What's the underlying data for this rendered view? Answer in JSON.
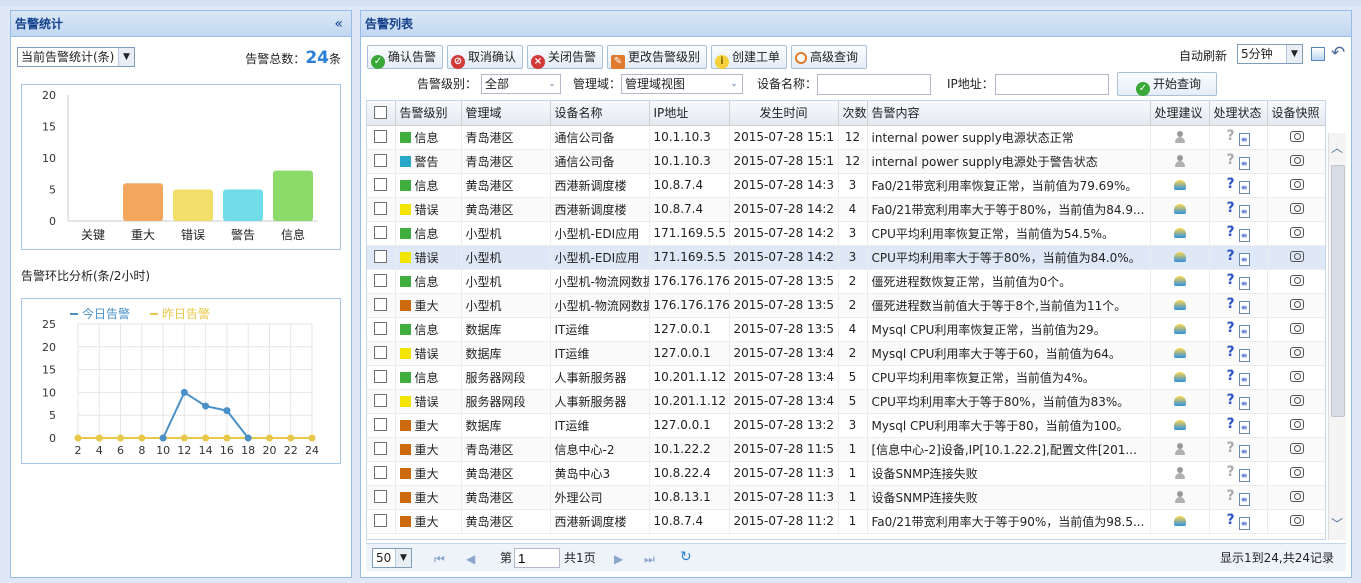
{
  "left_panel": {
    "title": "告警统计",
    "stat_select": "当前告警统计(条)",
    "total_label": "告警总数：",
    "total_value": "24",
    "total_unit": "条",
    "trend_title": "告警环比分析(条/2小时)"
  },
  "right_panel": {
    "title": "告警列表",
    "toolbar": [
      {
        "label": "确认告警",
        "icon": "check-icon"
      },
      {
        "label": "取消确认",
        "icon": "cancel-icon"
      },
      {
        "label": "关闭告警",
        "icon": "close-icon"
      },
      {
        "label": "更改告警级别",
        "icon": "edit-icon"
      },
      {
        "label": "创建工单",
        "icon": "lightbulb-icon"
      },
      {
        "label": "高级查询",
        "icon": "search-icon"
      }
    ],
    "auto_refresh_label": "自动刷新",
    "auto_refresh_value": "5分钟",
    "filters": {
      "level_label": "告警级别：",
      "level_value": "全部",
      "domain_label": "管理域：",
      "domain_value": "管理域视图",
      "device_label": "设备名称：",
      "device_value": "",
      "ip_label": "IP地址：",
      "ip_value": "",
      "search_label": "开始查询"
    },
    "columns": [
      "告警级别",
      "管理域",
      "设备名称",
      "IP地址",
      "发生时间",
      "次数",
      "告警内容",
      "处理建议",
      "处理状态",
      "设备快照"
    ],
    "rows": [
      {
        "level": "信息",
        "color": "#3fae3f",
        "domain": "青岛港区",
        "device": "通信公司备",
        "ip": "10.1.10.3",
        "time": "2015-07-28 15:1",
        "count": "12",
        "content": "internal power supply电源状态正常",
        "sugg": "person"
      },
      {
        "level": "警告",
        "color": "#29a7c8",
        "domain": "青岛港区",
        "device": "通信公司备",
        "ip": "10.1.10.3",
        "time": "2015-07-28 15:1",
        "count": "12",
        "content": "internal power supply电源处于警告状态",
        "sugg": "person"
      },
      {
        "level": "信息",
        "color": "#3fae3f",
        "domain": "黄岛港区",
        "device": "西港新调度楼",
        "ip": "10.8.7.4",
        "time": "2015-07-28 14:3",
        "count": "3",
        "content": "Fa0/21带宽利用率恢复正常，当前值为79.69%。",
        "sugg": "bulb"
      },
      {
        "level": "错误",
        "color": "#f2e600",
        "domain": "黄岛港区",
        "device": "西港新调度楼",
        "ip": "10.8.7.4",
        "time": "2015-07-28 14:2",
        "count": "4",
        "content": "Fa0/21带宽利用率大于等于80%，当前值为84.9...",
        "sugg": "bulb"
      },
      {
        "level": "信息",
        "color": "#3fae3f",
        "domain": "小型机",
        "device": "小型机-EDI应用",
        "ip": "171.169.5.5",
        "time": "2015-07-28 14:2",
        "count": "3",
        "content": "CPU平均利用率恢复正常，当前值为54.5%。",
        "sugg": "bulb"
      },
      {
        "level": "错误",
        "color": "#f2e600",
        "domain": "小型机",
        "device": "小型机-EDI应用",
        "ip": "171.169.5.5",
        "time": "2015-07-28 14:2",
        "count": "3",
        "content": "CPU平均利用率大于等于80%，当前值为84.0%。",
        "sugg": "bulb",
        "hl": true
      },
      {
        "level": "信息",
        "color": "#3fae3f",
        "domain": "小型机",
        "device": "小型机-物流网数据",
        "ip": "176.176.176",
        "time": "2015-07-28 13:5",
        "count": "2",
        "content": "僵死进程数恢复正常，当前值为0个。",
        "sugg": "bulb"
      },
      {
        "level": "重大",
        "color": "#cc6a10",
        "domain": "小型机",
        "device": "小型机-物流网数据",
        "ip": "176.176.176",
        "time": "2015-07-28 13:5",
        "count": "2",
        "content": "僵死进程数当前值大于等于8个,当前值为11个。",
        "sugg": "bulb"
      },
      {
        "level": "信息",
        "color": "#3fae3f",
        "domain": "数据库",
        "device": "IT运维",
        "ip": "127.0.0.1",
        "time": "2015-07-28 13:5",
        "count": "4",
        "content": "Mysql CPU利用率恢复正常，当前值为29。",
        "sugg": "bulb"
      },
      {
        "level": "错误",
        "color": "#f2e600",
        "domain": "数据库",
        "device": "IT运维",
        "ip": "127.0.0.1",
        "time": "2015-07-28 13:4",
        "count": "2",
        "content": "Mysql CPU利用率大于等于60，当前值为64。",
        "sugg": "bulb"
      },
      {
        "level": "信息",
        "color": "#3fae3f",
        "domain": "服务器网段",
        "device": "人事新服务器",
        "ip": "10.201.1.12",
        "time": "2015-07-28 13:4",
        "count": "5",
        "content": "CPU平均利用率恢复正常，当前值为4%。",
        "sugg": "bulb"
      },
      {
        "level": "错误",
        "color": "#f2e600",
        "domain": "服务器网段",
        "device": "人事新服务器",
        "ip": "10.201.1.12",
        "time": "2015-07-28 13:4",
        "count": "5",
        "content": "CPU平均利用率大于等于80%，当前值为83%。",
        "sugg": "bulb"
      },
      {
        "level": "重大",
        "color": "#cc6a10",
        "domain": "数据库",
        "device": "IT运维",
        "ip": "127.0.0.1",
        "time": "2015-07-28 13:2",
        "count": "3",
        "content": "Mysql CPU利用率大于等于80，当前值为100。",
        "sugg": "bulb"
      },
      {
        "level": "重大",
        "color": "#cc6a10",
        "domain": "青岛港区",
        "device": "信息中心-2",
        "ip": "10.1.22.2",
        "time": "2015-07-28 11:5",
        "count": "1",
        "content": "[信息中心-2]设备,IP[10.1.22.2],配置文件[201...",
        "sugg": "person"
      },
      {
        "level": "重大",
        "color": "#cc6a10",
        "domain": "黄岛港区",
        "device": "黄岛中心3",
        "ip": "10.8.22.4",
        "time": "2015-07-28 11:3",
        "count": "1",
        "content": "设备SNMP连接失败",
        "sugg": "person"
      },
      {
        "level": "重大",
        "color": "#cc6a10",
        "domain": "黄岛港区",
        "device": "外理公司",
        "ip": "10.8.13.1",
        "time": "2015-07-28 11:3",
        "count": "1",
        "content": "设备SNMP连接失败",
        "sugg": "person"
      },
      {
        "level": "重大",
        "color": "#cc6a10",
        "domain": "黄岛港区",
        "device": "西港新调度楼",
        "ip": "10.8.7.4",
        "time": "2015-07-28 11:2",
        "count": "1",
        "content": "Fa0/21带宽利用率大于等于90%，当前值为98.5...",
        "sugg": "bulb"
      }
    ],
    "pager": {
      "page_size": "50",
      "page_prefix": "第",
      "page_value": "1",
      "page_total": "共1页",
      "summary": "显示1到24,共24记录"
    }
  },
  "chart_data": [
    {
      "type": "bar",
      "categories": [
        "关键",
        "重大",
        "错误",
        "警告",
        "信息"
      ],
      "values": [
        0,
        6,
        5,
        5,
        8
      ],
      "colors": [
        "#f29c4c",
        "#f29c4c",
        "#f0dc5a",
        "#5fd8e6",
        "#7fd65a"
      ],
      "ylim": [
        0,
        20
      ],
      "yticks": [
        0,
        5,
        10,
        15,
        20
      ]
    },
    {
      "type": "line",
      "x": [
        2,
        4,
        6,
        8,
        10,
        12,
        14,
        16,
        18,
        20,
        22,
        24
      ],
      "series": [
        {
          "name": "今日告警",
          "color": "#4a90c8",
          "values": [
            null,
            null,
            null,
            null,
            0,
            10,
            7,
            6,
            0,
            null,
            null,
            null
          ]
        },
        {
          "name": "昨日告警",
          "color": "#e8c84a",
          "values": [
            0,
            0,
            0,
            0,
            0,
            0,
            0,
            0,
            0,
            0,
            0,
            0
          ]
        }
      ],
      "ylim": [
        0,
        25
      ],
      "yticks": [
        0,
        5,
        10,
        15,
        20,
        25
      ]
    }
  ]
}
